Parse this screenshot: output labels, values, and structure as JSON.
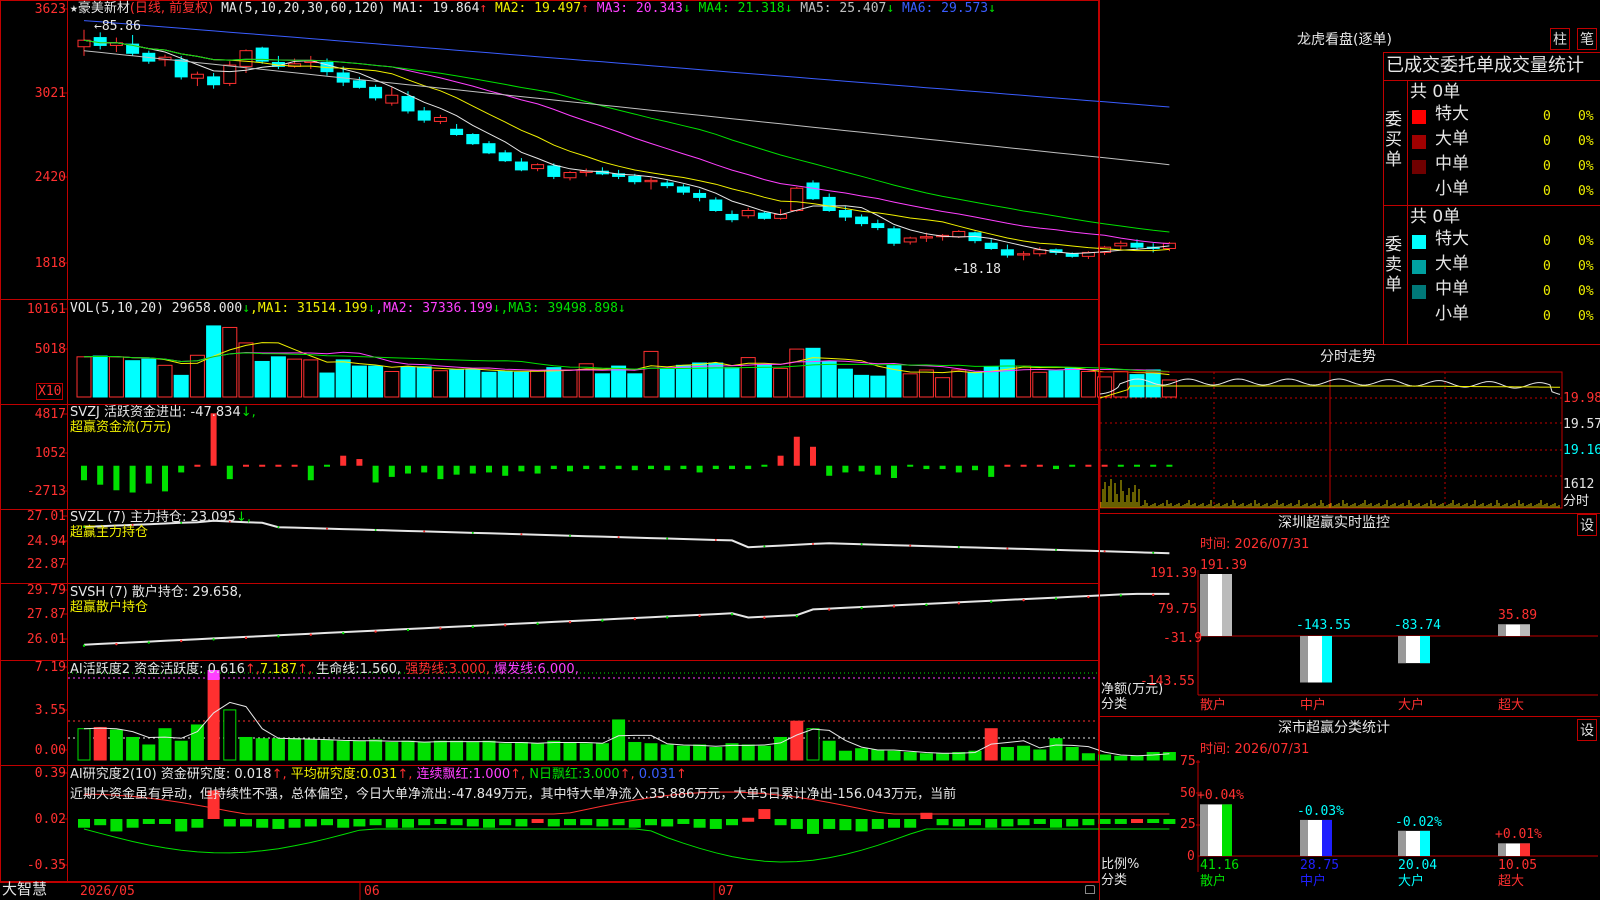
{
  "app_name": "大智慧",
  "stock": {
    "star": "★",
    "name": "豪美新材",
    "period": "(日线, 前复权)",
    "ma_text": "MA(5,10,20,30,60,120)",
    "ma": [
      {
        "label": "MA1:",
        "value": "19.864",
        "arrow": "↑",
        "color": "#e6e6e6"
      },
      {
        "label": "MA2:",
        "value": "19.497",
        "arrow": "↑",
        "color": "#f0f000"
      },
      {
        "label": "MA3:",
        "value": "20.343",
        "arrow": "↓",
        "color": "#ff40ff"
      },
      {
        "label": "MA4:",
        "value": "21.318",
        "arrow": "↓",
        "color": "#00e000"
      },
      {
        "label": "MA5:",
        "value": "25.407",
        "arrow": "↓",
        "color": "#c0c0c0"
      },
      {
        "label": "MA6:",
        "value": "29.573",
        "arrow": "↓",
        "color": "#3a5dff"
      }
    ],
    "high_marker": "←85.86",
    "low_marker": "←18.18"
  },
  "colors": {
    "up": "#ff3030",
    "down": "#00ffff",
    "grid": "#c00000",
    "text": "#c8c8c8"
  },
  "axes": {
    "price": [
      "3623",
      "3021",
      "2420",
      "1818"
    ],
    "vol": [
      "10161",
      "5018"
    ],
    "vol_unit": "X10",
    "svzj": [
      "4817",
      "1052",
      "-2713"
    ],
    "svzl": [
      "27.01",
      "24.94",
      "22.87"
    ],
    "svsh": [
      "29.79",
      "27.87",
      "26.01"
    ],
    "ai1": [
      "7.19",
      "3.55",
      "0.00"
    ],
    "ai2": [
      "0.39",
      "0.02",
      "-0.35"
    ],
    "dates": [
      "2026/05",
      "06",
      "07"
    ]
  },
  "panels": {
    "vol": {
      "title": "VOL(5,10,20)",
      "value": "29658.000",
      "arrow": "↓",
      "ma": [
        {
          "label": "MA1:",
          "value": "31514.199",
          "arrow": "↓",
          "color": "#f0f000"
        },
        {
          "label": "MA2:",
          "value": "37336.199",
          "arrow": "↓",
          "color": "#ff40ff"
        },
        {
          "label": "MA3:",
          "value": "39498.898",
          "arrow": "↓",
          "color": "#00e000"
        }
      ]
    },
    "svzj": {
      "title": "SVZJ  活跃资金进出:",
      "value": "-47.834",
      "arrow": "↓,",
      "sub": "超赢资金流(万元)"
    },
    "svzl": {
      "title": "SVZL (7) 主力持仓:",
      "value": "23.095",
      "arrow": "↓,",
      "sub": "超赢主力持仓"
    },
    "svsh": {
      "title": "SVSH (7) 散户持仓:",
      "value": "29.658",
      "arrow": ",",
      "sub": "超赢散户持仓"
    },
    "ai1": {
      "title": "AI活跃度2 资金活跃度:",
      "v1": "0.616",
      "v2": "7.187",
      "life_label": "生命线:",
      "life": "1.560",
      "strong_label": "强势线:",
      "strong": "3.000",
      "burst_label": "爆发线:",
      "burst": "6.000"
    },
    "ai2": {
      "title": "AI研究度2(10) 资金研究度:",
      "v1": "0.018",
      "avg_label": "平均研究度:",
      "avg": "0.031",
      "cont_label": "连续飘红:",
      "cont": "1.000",
      "n_label": "N日飘红:",
      "n": "3.000",
      "last": "0.031",
      "comment": "近期大资金虽有异动，但持续性不强，总体偏空，今日大单净流出:-47.849万元，其中特大单净流入:35.886万元，大单5日累计净出-156.043万元，当前"
    }
  },
  "right": {
    "lhb_title": "龙虎看盘(逐单)",
    "btn_bar": "柱",
    "btn_pen": "笔",
    "stats_header": "已成交委托单成交量统计",
    "buy_label": "委买单",
    "sell_label": "委卖单",
    "buy_total": "共 0单",
    "sell_total": "共 0单",
    "buy_rows": [
      {
        "name": "特大",
        "count": "0",
        "pct": "0%",
        "color": "#ff0000"
      },
      {
        "name": "大单",
        "count": "0",
        "pct": "0%",
        "color": "#a00000"
      },
      {
        "name": "中单",
        "count": "0",
        "pct": "0%",
        "color": "#700000"
      },
      {
        "name": "小单",
        "count": "0",
        "pct": "0%",
        "color": ""
      }
    ],
    "sell_rows": [
      {
        "name": "特大",
        "count": "0",
        "pct": "0%",
        "color": "#00ffff"
      },
      {
        "name": "大单",
        "count": "0",
        "pct": "0%",
        "color": "#00a0a0"
      },
      {
        "name": "中单",
        "count": "0",
        "pct": "0%",
        "color": "#007878"
      },
      {
        "name": "小单",
        "count": "0",
        "pct": "0%",
        "color": ""
      }
    ],
    "intraday_title": "分时走势",
    "intraday_axis": [
      "19.98",
      "19.57",
      "19.16"
    ],
    "intraday_vol": "1612",
    "intraday_unit": "分时",
    "monitor_title": "深圳超赢实时监控",
    "monitor_settings": "设",
    "monitor_time": "时间: 2026/07/31",
    "monitor_axis": [
      "191.39",
      "79.75",
      "-31.9",
      "-143.55"
    ],
    "monitor_ylabel": "净额(万元)",
    "monitor_xlabel": "分类",
    "monitor_categories": [
      "散户",
      "中户",
      "大户",
      "超大"
    ],
    "monitor_values": [
      191.39,
      -143.55,
      -83.74,
      35.89
    ],
    "monitor_value_labels": [
      "191.39",
      "-143.55",
      "-83.74",
      "35.89"
    ],
    "class_title": "深市超赢分类统计",
    "class_settings": "设",
    "class_time": "时间: 2026/07/31",
    "class_axis": [
      "75",
      "50",
      "25",
      "0"
    ],
    "class_ylabel": "比例%",
    "class_xlabel": "分类",
    "class_categories": [
      "散户",
      "中户",
      "大户",
      "超大"
    ],
    "class_values": [
      41.16,
      28.75,
      20.04,
      10.05
    ],
    "class_value_labels": [
      "41.16",
      "28.75",
      "20.04",
      "10.05"
    ],
    "class_changes": [
      "+0.04%",
      "-0.03%",
      "-0.02%",
      "+0.01%"
    ]
  },
  "chart_data": [
    {
      "type": "candlestick",
      "title": "豪美新材 (日线, 前复权)",
      "x_ticks": [
        "2026/05",
        "06",
        "07"
      ],
      "ylim": [
        1700,
        3700
      ],
      "ohlc": [
        [
          3450,
          3580,
          3380,
          3500
        ],
        [
          3520,
          3560,
          3430,
          3460
        ],
        [
          3460,
          3520,
          3410,
          3480
        ],
        [
          3470,
          3540,
          3380,
          3400
        ],
        [
          3400,
          3420,
          3320,
          3340
        ],
        [
          3350,
          3390,
          3300,
          3370
        ],
        [
          3350,
          3380,
          3200,
          3220
        ],
        [
          3210,
          3260,
          3150,
          3240
        ],
        [
          3220,
          3250,
          3130,
          3160
        ],
        [
          3170,
          3340,
          3150,
          3310
        ],
        [
          3300,
          3430,
          3250,
          3420
        ],
        [
          3440,
          3450,
          3320,
          3340
        ],
        [
          3330,
          3380,
          3280,
          3300
        ],
        [
          3300,
          3360,
          3290,
          3320
        ],
        [
          3330,
          3380,
          3280,
          3340
        ],
        [
          3330,
          3360,
          3230,
          3260
        ],
        [
          3250,
          3300,
          3150,
          3180
        ],
        [
          3190,
          3220,
          3130,
          3140
        ],
        [
          3140,
          3160,
          3040,
          3060
        ],
        [
          3020,
          3140,
          3000,
          3080
        ],
        [
          3070,
          3110,
          2940,
          2960
        ],
        [
          2960,
          2990,
          2870,
          2890
        ],
        [
          2880,
          2930,
          2860,
          2910
        ],
        [
          2820,
          2860,
          2770,
          2780
        ],
        [
          2780,
          2790,
          2700,
          2710
        ],
        [
          2710,
          2730,
          2630,
          2640
        ],
        [
          2640,
          2660,
          2570,
          2580
        ],
        [
          2570,
          2600,
          2500,
          2510
        ],
        [
          2520,
          2560,
          2500,
          2550
        ],
        [
          2540,
          2560,
          2440,
          2460
        ],
        [
          2450,
          2500,
          2430,
          2490
        ],
        [
          2490,
          2520,
          2460,
          2500
        ],
        [
          2500,
          2530,
          2470,
          2480
        ],
        [
          2480,
          2510,
          2440,
          2460
        ],
        [
          2460,
          2480,
          2400,
          2420
        ],
        [
          2420,
          2450,
          2360,
          2430
        ],
        [
          2410,
          2430,
          2370,
          2390
        ],
        [
          2380,
          2400,
          2320,
          2340
        ],
        [
          2330,
          2360,
          2270,
          2300
        ],
        [
          2280,
          2300,
          2190,
          2200
        ],
        [
          2170,
          2200,
          2110,
          2130
        ],
        [
          2160,
          2220,
          2140,
          2200
        ],
        [
          2180,
          2190,
          2130,
          2140
        ],
        [
          2140,
          2210,
          2130,
          2170
        ],
        [
          2200,
          2380,
          2190,
          2370
        ],
        [
          2410,
          2430,
          2280,
          2290
        ],
        [
          2300,
          2330,
          2190,
          2200
        ],
        [
          2200,
          2230,
          2120,
          2150
        ],
        [
          2150,
          2170,
          2080,
          2100
        ],
        [
          2100,
          2130,
          2050,
          2070
        ],
        [
          2060,
          2080,
          1930,
          1950
        ],
        [
          1960,
          2000,
          1940,
          1990
        ],
        [
          1990,
          2030,
          1960,
          2000
        ],
        [
          2000,
          2020,
          1970,
          2010
        ],
        [
          2000,
          2050,
          1990,
          2040
        ],
        [
          2030,
          2040,
          1950,
          1970
        ],
        [
          1950,
          1980,
          1900,
          1910
        ],
        [
          1900,
          1940,
          1840,
          1860
        ],
        [
          1860,
          1890,
          1820,
          1870
        ],
        [
          1870,
          1920,
          1850,
          1900
        ],
        [
          1900,
          1910,
          1860,
          1880
        ],
        [
          1870,
          1880,
          1840,
          1850
        ],
        [
          1850,
          1890,
          1830,
          1880
        ],
        [
          1880,
          1930,
          1860,
          1920
        ],
        [
          1930,
          1970,
          1900,
          1950
        ],
        [
          1950,
          1980,
          1900,
          1920
        ],
        [
          1920,
          1950,
          1880,
          1910
        ],
        [
          1910,
          1960,
          1890,
          1950
        ]
      ]
    },
    {
      "type": "bar",
      "title": "VOL(5,10,20)",
      "ylim": [
        0,
        11000
      ],
      "values": [
        5200,
        5300,
        5200,
        4700,
        4900,
        4100,
        2800,
        5400,
        9200,
        9000,
        7000,
        4600,
        5200,
        4900,
        4800,
        3100,
        4800,
        4000,
        4000,
        3300,
        3900,
        3900,
        3400,
        3500,
        3500,
        3200,
        3300,
        3200,
        3400,
        3800,
        3500,
        4300,
        3000,
        4000,
        3000,
        5900,
        3600,
        4100,
        4400,
        4400,
        3800,
        5100,
        4200,
        3700,
        6200,
        6300,
        4600,
        3600,
        2800,
        2700,
        4100,
        3000,
        3500,
        2500,
        3500,
        3200,
        3900,
        4800,
        4000,
        3200,
        3400,
        3700,
        3300,
        2600,
        3300,
        2900,
        3500,
        2200
      ]
    },
    {
      "type": "bar",
      "title": "SVZJ 活跃资金进出",
      "ylim": [
        -2713,
        4817
      ],
      "values": [
        -1300,
        -1700,
        -2200,
        -2400,
        -1600,
        -2300,
        -600,
        250,
        4700,
        -1200,
        200,
        180,
        150,
        180,
        -1300,
        -200,
        900,
        600,
        -1500,
        -1000,
        -700,
        -600,
        -1200,
        -800,
        -700,
        -600,
        -900,
        -500,
        -700,
        -300,
        -500,
        -300,
        -300,
        -300,
        -400,
        -300,
        -400,
        -300,
        -600,
        -300,
        -300,
        -300,
        -200,
        900,
        2600,
        1700,
        -900,
        -600,
        -500,
        -800,
        -1100,
        -200,
        -300,
        -300,
        -600,
        -400,
        -1000,
        200,
        150,
        200,
        -300,
        -200,
        200,
        100,
        -200,
        -200,
        -150,
        -100
      ]
    },
    {
      "type": "line",
      "title": "SVZL (7) 主力持仓",
      "ylim": [
        22.87,
        27.01
      ],
      "last": 23.095
    },
    {
      "type": "line",
      "title": "SVSH (7) 散户持仓",
      "ylim": [
        26.01,
        29.79
      ],
      "last": 29.658
    },
    {
      "type": "bar",
      "title": "AI活跃度2",
      "ylim": [
        0,
        7.19
      ],
      "values": [
        2.5,
        2.6,
        2.4,
        1.8,
        1.2,
        2.5,
        1.5,
        2.8,
        7.0,
        4.0,
        1.8,
        1.7,
        1.7,
        1.7,
        1.6,
        1.6,
        1.5,
        1.5,
        1.6,
        1.4,
        1.5,
        1.4,
        1.5,
        1.5,
        1.4,
        1.5,
        1.3,
        1.4,
        1.3,
        1.5,
        1.4,
        1.3,
        1.3,
        3.2,
        1.4,
        1.3,
        1.2,
        1.1,
        1.2,
        1.0,
        1.3,
        1.2,
        1.1,
        1.8,
        3.1,
        2.5,
        1.5,
        0.7,
        0.9,
        0.8,
        0.7,
        0.6,
        0.5,
        0.5,
        0.6,
        0.7,
        2.5,
        1.0,
        1.1,
        0.8,
        1.7,
        1.0,
        0.5,
        0.4,
        0.3,
        0.3,
        0.6,
        0.6
      ]
    },
    {
      "type": "bar",
      "title": "AI研究度2(10)",
      "ylim": [
        -0.35,
        0.39
      ],
      "values": [
        -0.05,
        -0.03,
        -0.08,
        -0.05,
        -0.02,
        -0.02,
        -0.08,
        -0.05,
        0.25,
        -0.04,
        -0.04,
        -0.05,
        -0.06,
        -0.05,
        -0.04,
        -0.03,
        -0.05,
        -0.04,
        -0.03,
        -0.05,
        -0.05,
        -0.03,
        -0.02,
        -0.03,
        -0.04,
        -0.05,
        -0.03,
        -0.04,
        0.02,
        -0.04,
        -0.03,
        -0.03,
        -0.04,
        -0.03,
        -0.05,
        -0.03,
        -0.04,
        -0.02,
        -0.05,
        -0.06,
        -0.03,
        0.03,
        0.1,
        -0.03,
        -0.06,
        -0.1,
        -0.06,
        -0.07,
        -0.08,
        -0.06,
        -0.05,
        -0.05,
        0.07,
        -0.03,
        -0.04,
        -0.03,
        -0.05,
        -0.04,
        -0.03,
        -0.02,
        -0.05,
        -0.04,
        -0.03,
        -0.02,
        -0.02,
        0.02,
        -0.01,
        -0.02
      ]
    }
  ]
}
